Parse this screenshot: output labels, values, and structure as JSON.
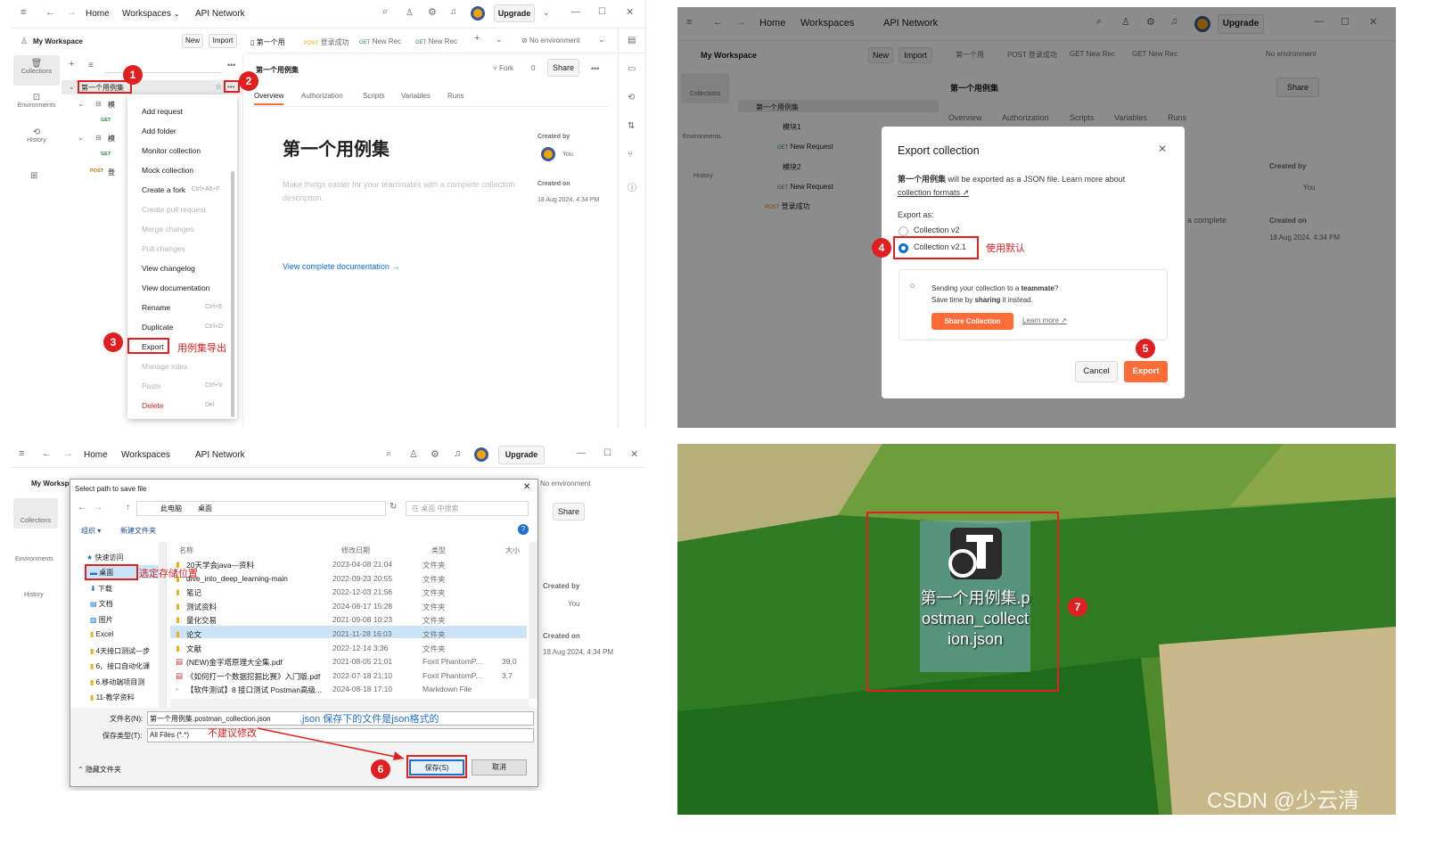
{
  "app": {
    "nav_home": "Home",
    "nav_workspaces": "Workspaces",
    "nav_api_network": "API Network",
    "upgrade": "Upgrade",
    "workspace": "My Workspace",
    "workspace_short": "My Worksp",
    "new": "New",
    "import": "Import",
    "no_environment": "No environment",
    "tabs": [
      "第一个用",
      "POST 登录成功",
      "GET New Rec",
      "GET New Rec"
    ],
    "tab_methods": [
      "",
      "POST",
      "GET",
      "GET"
    ],
    "tab_names": [
      "第一个用",
      "登录成功",
      "New Rec",
      "New Rec"
    ],
    "sidebar": [
      "Collections",
      "Environments",
      "History"
    ]
  },
  "p1": {
    "collection_name": "第一个用例集",
    "fork": "Fork",
    "fork_count": "0",
    "share": "Share",
    "overview_tabs": [
      "Overview",
      "Authorization",
      "Scripts",
      "Variables",
      "Runs"
    ],
    "title": "第一个用例集",
    "desc": "Make things easier for your teammates with a complete collection description.",
    "view_doc": "View complete documentation →",
    "created_by_label": "Created by",
    "created_by": "You",
    "created_on_label": "Created on",
    "created_on": "18 Aug 2024, 4:34 PM",
    "tree": [
      "模",
      "模"
    ],
    "get": "GET",
    "post": "POST",
    "post_name": "登",
    "menu": [
      {
        "label": "Add request",
        "shortcut": "",
        "disabled": false
      },
      {
        "label": "Add folder",
        "shortcut": "",
        "disabled": false
      },
      {
        "label": "Monitor collection",
        "shortcut": "",
        "disabled": false
      },
      {
        "label": "Mock collection",
        "shortcut": "",
        "disabled": false
      },
      {
        "label": "Create a fork",
        "shortcut": "Ctrl+Alt+F",
        "disabled": false
      },
      {
        "label": "Create pull request",
        "shortcut": "",
        "disabled": true
      },
      {
        "label": "Merge changes",
        "shortcut": "",
        "disabled": true
      },
      {
        "label": "Pull changes",
        "shortcut": "",
        "disabled": true
      },
      {
        "label": "View changelog",
        "shortcut": "",
        "disabled": false
      },
      {
        "label": "View documentation",
        "shortcut": "",
        "disabled": false
      },
      {
        "label": "Rename",
        "shortcut": "Ctrl+E",
        "disabled": false
      },
      {
        "label": "Duplicate",
        "shortcut": "Ctrl+D",
        "disabled": false
      },
      {
        "label": "Export",
        "shortcut": "",
        "disabled": false
      },
      {
        "label": "Manage roles",
        "shortcut": "",
        "disabled": true
      },
      {
        "label": "Paste",
        "shortcut": "Ctrl+V",
        "disabled": true
      },
      {
        "label": "Delete",
        "shortcut": "Del",
        "disabled": false
      }
    ],
    "annot_export": "用例集导出",
    "badges": [
      "1",
      "2",
      "3"
    ]
  },
  "p2": {
    "collection_name": "第一个用例集",
    "tree": [
      "第一个用例集",
      "模块1",
      "New Request",
      "模块2",
      "New Request",
      "登录成功"
    ],
    "dialog_title": "Export collection",
    "dialog_desc_bold": "第一个用例集",
    "dialog_desc": " will be exported as a JSON file. Learn more about",
    "collection_formats": "collection formats ↗",
    "export_as": "Export as:",
    "opt_v2": "Collection v2",
    "opt_v21": "Collection v2.1",
    "annot_default": "使用默认",
    "share_line1_a": "Sending your collection to a ",
    "share_line1_b": "teammate",
    "share_line1_c": "?",
    "share_line2_a": "Save time by ",
    "share_line2_b": "sharing",
    "share_line2_c": " it instead.",
    "share_collection": "Share Collection",
    "learn_more": "Learn more ↗",
    "cancel": "Cancel",
    "export": "Export",
    "badges": [
      "4",
      "5"
    ],
    "bg_complete": "a complete",
    "created_by": "You",
    "created_by_label": "Created by",
    "created_on_label": "Created on",
    "created_on": "18 Aug 2024, 4:34 PM"
  },
  "p3": {
    "dialog_title": "Select path to save file",
    "breadcrumb": [
      "此电脑",
      "桌面"
    ],
    "search_placeholder": "在 桌面 中搜索",
    "organize": "组织 ▾",
    "new_folder": "新建文件夹",
    "quick_access": "快速访问",
    "nav_items": [
      "桌面",
      "下载",
      "文档",
      "图片",
      "Excel",
      "4天接口测试—步",
      "6、接口自动化课",
      "6.移动端项目测",
      "11-教学资料"
    ],
    "annot_location": "选定存储位置",
    "columns": [
      "名称",
      "修改日期",
      "类型",
      "大小"
    ],
    "files": [
      {
        "name": "20天学会java—资料",
        "date": "2023-04-08 21:04",
        "type": "文件夹",
        "size": ""
      },
      {
        "name": "dive_into_deep_learning-main",
        "date": "2022-09-23 20:55",
        "type": "文件夹",
        "size": ""
      },
      {
        "name": "笔记",
        "date": "2022-12-03 21:56",
        "type": "文件夹",
        "size": ""
      },
      {
        "name": "测试资料",
        "date": "2024-08-17 15:28",
        "type": "文件夹",
        "size": ""
      },
      {
        "name": "量化交易",
        "date": "2021-09-08 10:23",
        "type": "文件夹",
        "size": ""
      },
      {
        "name": "论文",
        "date": "2021-11-28 16:03",
        "type": "文件夹",
        "size": ""
      },
      {
        "name": "文献",
        "date": "2022-12-14 3:36",
        "type": "文件夹",
        "size": ""
      },
      {
        "name": "(NEW)金字塔原理大全集.pdf",
        "date": "2021-08-05 21:01",
        "type": "Foxit PhantomP...",
        "size": "39,0"
      },
      {
        "name": "《如何打一个数据挖掘比赛》入门版.pdf",
        "date": "2022-07-18 21:10",
        "type": "Foxit PhantomP...",
        "size": "3,7"
      },
      {
        "name": "【软件测试】8 接口测试 Postman高级...",
        "date": "2024-08-18 17:10",
        "type": "Markdown File",
        "size": ""
      }
    ],
    "filename_label": "文件名(N):",
    "filename": "第一个用例集.postman_collection.json",
    "filetype_label": "保存类型(T):",
    "filetype": "All Files (*.*)",
    "annot_json": ".json 保存下的文件是json格式的",
    "annot_nochange": "不建议修改",
    "hide_folders": "隐藏文件夹",
    "save": "保存(S)",
    "cancel": "取消",
    "badge": "6",
    "share": "Share",
    "created_by_label": "Created by",
    "created_by": "You",
    "created_on_label": "Created on",
    "created_on": "18 Aug 2024, 4:34 PM"
  },
  "p4": {
    "file_label": "第一个用例集.postman_collection.json",
    "badge": "7",
    "watermark": "CSDN @少云清"
  },
  "colors": {
    "accent": "#ff6c37",
    "red": "#e02020",
    "blue": "#0b6cd7"
  }
}
